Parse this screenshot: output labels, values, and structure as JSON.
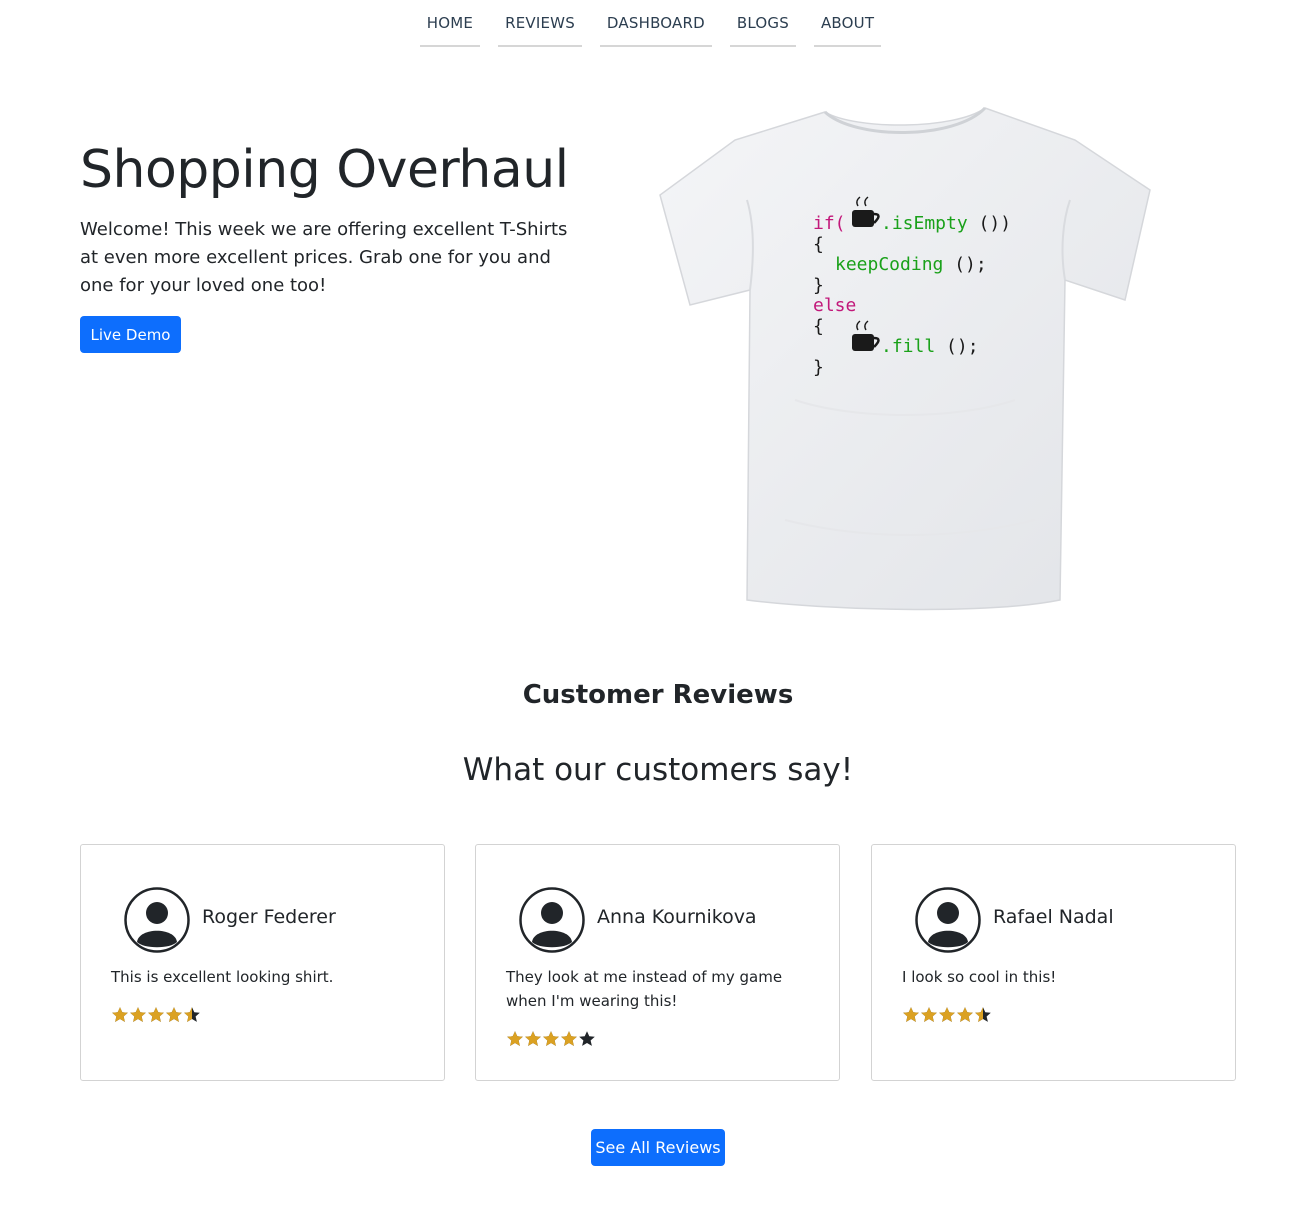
{
  "nav": {
    "items": [
      {
        "label": "HOME"
      },
      {
        "label": "REVIEWS"
      },
      {
        "label": "DASHBOARD"
      },
      {
        "label": "BLOGS"
      },
      {
        "label": "ABOUT"
      }
    ]
  },
  "hero": {
    "title": "Shopping Overhaul",
    "text": "Welcome! This week we are offering excellent T-Shirts at even more excellent prices. Grab one for you and one for your loved one too!",
    "button_label": "Live Demo",
    "shirt_code": {
      "line1_keyword": "if(",
      "line1_method": ".isEmpty",
      "line1_end": "())",
      "open_brace": "{",
      "line3": "keepCoding",
      "line3_end": "();",
      "close_brace": "}",
      "else_keyword": "else",
      "line7_method": ".fill",
      "line7_end": "();"
    }
  },
  "reviews": {
    "heading": "Customer Reviews",
    "subheading": "What our customers say!",
    "items": [
      {
        "name": "Roger Federer",
        "text": "This is excellent looking shirt.",
        "rating": 4.5
      },
      {
        "name": "Anna Kournikova",
        "text": "They look at me instead of my game when I'm wearing this!",
        "rating": 4
      },
      {
        "name": "Rafael Nadal",
        "text": "I look so cool in this!",
        "rating": 4.5
      }
    ],
    "see_all_label": "See All Reviews"
  },
  "colors": {
    "accent": "#0d6efd",
    "star_filled": "#dba122",
    "star_empty": "#212529",
    "code_keyword": "#c2187a",
    "code_method": "#1aa11a"
  }
}
